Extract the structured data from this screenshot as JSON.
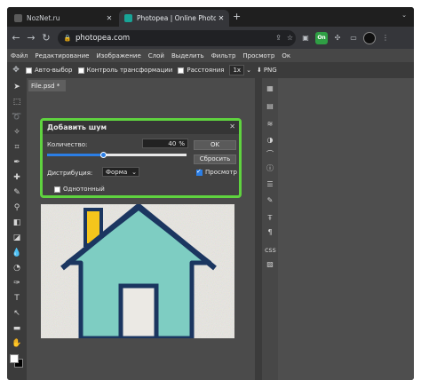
{
  "browser": {
    "tabs": [
      {
        "title": "NozNet.ru",
        "favicon_color": "#5a5a5a",
        "active": false
      },
      {
        "title": "Photopea | Online Photo Editor",
        "favicon_color": "#18a497",
        "active": true
      }
    ],
    "new_tab": "+",
    "url": "photopea.com",
    "ext_badge": "On"
  },
  "menubar": {
    "items": [
      "Файл",
      "Редактирование",
      "Изображение",
      "Слой",
      "Выделить",
      "Фильтр",
      "Просмотр",
      "Ок"
    ]
  },
  "options": {
    "auto_select": "Авто-выбор",
    "transform_control": "Контроль трансформации",
    "distances": "Расстояния",
    "zoom": "1x",
    "export_format": "PNG"
  },
  "document": {
    "tab_label": "File.psd *"
  },
  "dialog": {
    "title": "Добавить шум",
    "amount_label": "Количество:",
    "amount_value": "40",
    "amount_unit": "%",
    "amount_fraction": 0.4,
    "distribution_label": "Дистрибуция:",
    "distribution_value": "Форма",
    "monochrome_label": "Однотонный",
    "monochrome_checked": false,
    "preview_label": "Просмотр",
    "preview_checked": true,
    "ok_label": "OK",
    "reset_label": "Сбросить",
    "highlight_color": "#5fd33f"
  },
  "colors": {
    "accent": "#2b7ee5",
    "house_fill": "#7ecdc2",
    "house_stroke": "#1b3660",
    "chimney": "#f4c51c"
  }
}
